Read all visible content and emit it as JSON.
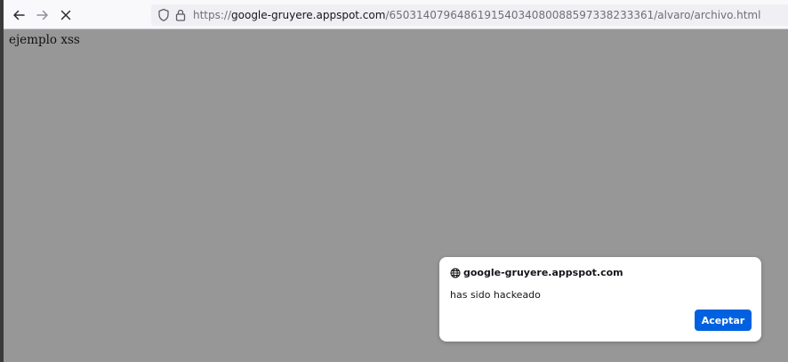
{
  "browser": {
    "url": {
      "scheme": "https://",
      "host": "google-gruyere.appspot.com",
      "path": "/650314079648619154034080088597338233361/alvaro/archivo.html"
    },
    "icons": {
      "back": "arrow-left-icon",
      "forward": "arrow-right-icon",
      "stop": "close-icon",
      "tracking": "shield-icon",
      "lock": "lock-icon"
    }
  },
  "page": {
    "text": "ejemplo xss"
  },
  "dialog": {
    "origin": "google-gruyere.appspot.com",
    "message": "has sido hackeado",
    "button_label": "Aceptar",
    "icon": "globe-icon",
    "accent_color": "#0061e0"
  }
}
